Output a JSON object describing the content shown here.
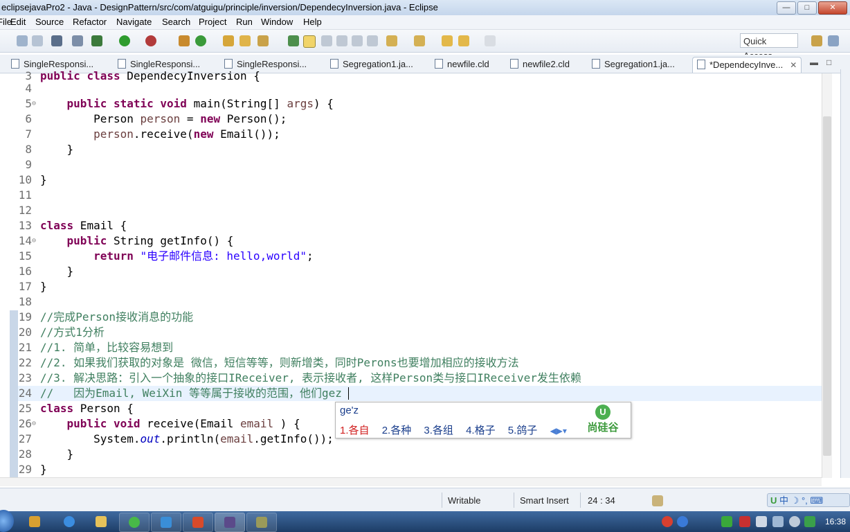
{
  "window": {
    "title": "eclipsejavaPro2 - Java - DesignPattern/src/com/atguigu/principle/inversion/DependecyInversion.java - Eclipse",
    "minimize": "—",
    "maximize": "□",
    "close": "✕"
  },
  "menu": [
    "File",
    "Edit",
    "Source",
    "Refactor",
    "Navigate",
    "Search",
    "Project",
    "Run",
    "Window",
    "Help"
  ],
  "toolbar": {
    "quick_access": "Quick Access"
  },
  "tabs": [
    {
      "label": "SingleResponsi..."
    },
    {
      "label": "SingleResponsi..."
    },
    {
      "label": "SingleResponsi..."
    },
    {
      "label": "Segregation1.ja..."
    },
    {
      "label": "newfile.cld"
    },
    {
      "label": "newfile2.cld"
    },
    {
      "label": "Segregation1.ja..."
    },
    {
      "label": "*DependecyInve...",
      "active": true
    }
  ],
  "code_lines": [
    {
      "n": "3",
      "text": "public class DependecyInversion {"
    },
    {
      "n": "4",
      "text": ""
    },
    {
      "n": "5",
      "text": "    public static void main(String[] args) {"
    },
    {
      "n": "6",
      "text": "        Person person = new Person();"
    },
    {
      "n": "7",
      "text": "        person.receive(new Email());"
    },
    {
      "n": "8",
      "text": "    }"
    },
    {
      "n": "9",
      "text": ""
    },
    {
      "n": "10",
      "text": "}"
    },
    {
      "n": "11",
      "text": ""
    },
    {
      "n": "12",
      "text": ""
    },
    {
      "n": "13",
      "text": "class Email {"
    },
    {
      "n": "14",
      "text": "    public String getInfo() {"
    },
    {
      "n": "15",
      "text": "        return \"电子邮件信息: hello,world\";"
    },
    {
      "n": "16",
      "text": "    }"
    },
    {
      "n": "17",
      "text": "}"
    },
    {
      "n": "18",
      "text": ""
    },
    {
      "n": "19",
      "text": "//完成Person接收消息的功能"
    },
    {
      "n": "20",
      "text": "//方式1分析"
    },
    {
      "n": "21",
      "text": "//1. 简单，比较容易想到"
    },
    {
      "n": "22",
      "text": "//2. 如果我们获取的对象是 微信，短信等等，则新增类，同时Perons也要增加相应的接收方法"
    },
    {
      "n": "23",
      "text": "//3. 解决思路：引入一个抽象的接口IReceiver, 表示接收者, 这样Person类与接口IReceiver发生依赖"
    },
    {
      "n": "24",
      "text": "//   因为Email, WeiXin 等等属于接收的范围，他们gez"
    },
    {
      "n": "25",
      "text": "class Person {"
    },
    {
      "n": "26",
      "text": "    public void receive(Email email ) {"
    },
    {
      "n": "27",
      "text": "        System.out.println(email.getInfo());"
    },
    {
      "n": "28",
      "text": "    }"
    },
    {
      "n": "29",
      "text": "}"
    }
  ],
  "ime": {
    "pinyin": "ge'z",
    "candidates": [
      "1.各自",
      "2.各种",
      "3.各组",
      "4.格子",
      "5.鸽子"
    ],
    "logo": "尚硅谷"
  },
  "status": {
    "writable": "Writable",
    "insert_mode": "Smart Insert",
    "position": "24 : 34"
  },
  "taskbar": {
    "clock": "16:38"
  }
}
